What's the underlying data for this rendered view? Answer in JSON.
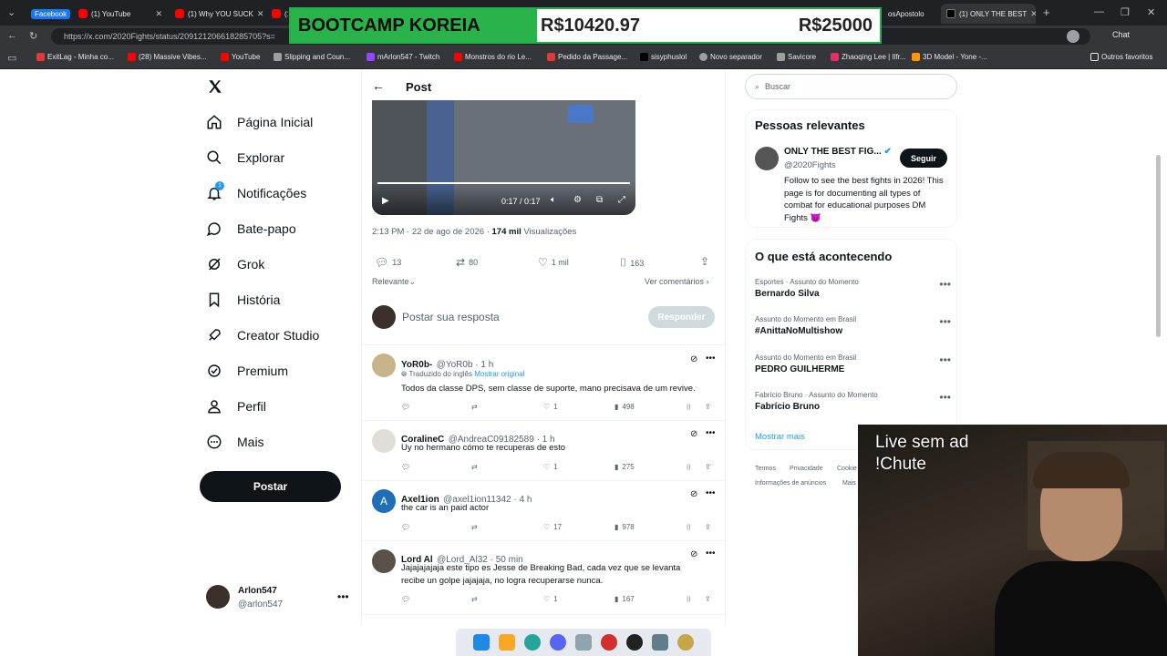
{
  "browser": {
    "tabs": [
      {
        "label": "Facebook",
        "chip": true
      },
      {
        "label": "(1) YouTube",
        "icon": "youtube"
      },
      {
        "label": "(1) Why YOU SUCK",
        "icon": "youtube"
      },
      {
        "label": "(1",
        "icon": "youtube"
      },
      {
        "label": "osApostolo",
        "icon": "none"
      },
      {
        "label": "(1) ONLY THE BEST",
        "icon": "x",
        "active": true
      }
    ],
    "url": "https://x.com/2020Fights/status/209121206618285705?s=",
    "chat_label": "Chat",
    "bookmarks": [
      {
        "label": "ExitLag - Minha co...",
        "color": "#e53935"
      },
      {
        "label": "(28) Massive Vibes...",
        "color": "#ff0000"
      },
      {
        "label": "YouTube",
        "color": "#ff0000"
      },
      {
        "label": "Slipping and Coun...",
        "color": "#9e9e9e"
      },
      {
        "label": "mArlon547 - Twitch",
        "color": "#9146ff"
      },
      {
        "label": "Monstros do rio Le...",
        "color": "#ff0000"
      },
      {
        "label": "Pedido da Passage...",
        "color": "#e53935"
      },
      {
        "label": "sisyphuslol",
        "color": "#000000"
      },
      {
        "label": "Novo separador",
        "color": "#9e9e9e"
      },
      {
        "label": "Savicore",
        "color": "#9e9e9e"
      },
      {
        "label": "Zhaoqing Lee | Ilfr...",
        "color": "#e1306c"
      },
      {
        "label": "3D Model - Yone -...",
        "color": "#ff9800"
      }
    ],
    "other_favorites": "Outros favoritos"
  },
  "overlay": {
    "left": "BOOTCAMP KOREIA",
    "mid": "R$10420.97",
    "right": "R$25000"
  },
  "nav": {
    "items": [
      {
        "label": "Página Inicial",
        "icon": "home-icon"
      },
      {
        "label": "Explorar",
        "icon": "search-icon"
      },
      {
        "label": "Notificações",
        "icon": "bell-icon",
        "badge": "1"
      },
      {
        "label": "Bate-papo",
        "icon": "chat-icon"
      },
      {
        "label": "Grok",
        "icon": "grok-icon"
      },
      {
        "label": "História",
        "icon": "bookmark-icon"
      },
      {
        "label": "Creator Studio",
        "icon": "rocket-icon"
      },
      {
        "label": "Premium",
        "icon": "verified-icon"
      },
      {
        "label": "Perfil",
        "icon": "person-icon"
      },
      {
        "label": "Mais",
        "icon": "more-circle-icon"
      }
    ],
    "post_button": "Postar",
    "account": {
      "name": "Arlon547",
      "handle": "@arlon547"
    }
  },
  "post": {
    "header": "Post",
    "video_time": "0:17 / 0:17",
    "meta_time": "2:13 PM · 22 de ago de 2026 ·",
    "views_count": "174 mil",
    "views_label": "Visualizações",
    "stats": {
      "replies": "13",
      "reposts": "80",
      "likes": "1 mil",
      "bookmarks": "163"
    },
    "sort_label": "Relevante",
    "see_comments": "Ver comentários",
    "reply_placeholder": "Postar sua resposta",
    "reply_button": "Responder"
  },
  "replies": [
    {
      "name": "YoR0b-",
      "handle": "@YoR0b · 1 h",
      "translated": "Traduzido do inglês",
      "show_original": "Mostrar original",
      "text": "Todos da classe DPS, sem classe de suporte, mano precisava de um revive.",
      "likes": "1",
      "views": "498"
    },
    {
      "name": "CoralineC",
      "handle": "@AndreaC09182589 · 1 h",
      "text": "Uy no hermano cómo te recuperas de esto",
      "likes": "1",
      "views": "275"
    },
    {
      "name": "Axel1ion",
      "handle": "@axel1ion11342 · 4 h",
      "text": "the car is an paid actor",
      "likes": "17",
      "views": "978",
      "avatar_letter": "A"
    },
    {
      "name": "Lord Al",
      "handle": "@Lord_Al32 · 50 min",
      "text": "Jajajajajaja este tipo es Jesse de Breaking Bad, cada vez que se levanta recibe un golpe jajajaja, no logra recuperarse nunca.",
      "likes": "1",
      "views": "167"
    }
  ],
  "sidebar": {
    "search_placeholder": "Buscar",
    "relevant_title": "Pessoas relevantes",
    "person": {
      "name": "ONLY THE BEST FIG...",
      "handle": "@2020Fights",
      "follow": "Seguir",
      "bio": "Follow to see the best fights in 2026! This page is for documenting all types of combat for educational purposes DM Fights 😈"
    },
    "trending_title": "O que está acontecendo",
    "trends": [
      {
        "category": "Esportes · Assunto do Momento",
        "name": "Bernardo Silva"
      },
      {
        "category": "Assunto do Momento em Brasil",
        "name": "#AnittaNoMultishow"
      },
      {
        "category": "Assunto do Momento em Brasil",
        "name": "PEDRO GUILHERME"
      },
      {
        "category": "Fabrício Bruno · Assunto do Momento",
        "name": "Fabrício Bruno"
      }
    ],
    "show_more": "Mostrar mais",
    "footer": [
      "Termos",
      "Privacidade",
      "Cookie",
      "Informações de anúncios",
      "Mais"
    ]
  },
  "webcam": {
    "line1": "Live sem ad",
    "line2": "!Chute"
  }
}
